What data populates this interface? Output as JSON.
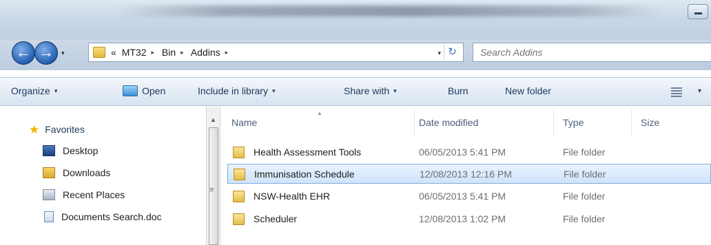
{
  "window": {
    "minimize_icon": "minimize-icon"
  },
  "navigation": {
    "back_icon": "back-arrow-icon",
    "forward_icon": "forward-arrow-icon",
    "back_glyph": "←",
    "forward_glyph": "→",
    "dropdown_glyph": "▾"
  },
  "address": {
    "overflow": "«",
    "crumbs": [
      "MT32",
      "Bin",
      "Addins"
    ],
    "separator": "▸",
    "refresh_glyph": "↻"
  },
  "search": {
    "placeholder": "Search Addins"
  },
  "toolbar": {
    "organize": "Organize",
    "open": "Open",
    "include_in_library": "Include in library",
    "share_with": "Share with",
    "burn": "Burn",
    "new_folder": "New folder",
    "arrow": "▾"
  },
  "navpane": {
    "favorites": "Favorites",
    "items": [
      {
        "label": "Desktop",
        "icon": "desktop-icon"
      },
      {
        "label": "Downloads",
        "icon": "downloads-folder-icon"
      },
      {
        "label": "Recent Places",
        "icon": "recent-places-icon"
      },
      {
        "label": "Documents Search.doc",
        "icon": "document-icon"
      }
    ]
  },
  "filelist": {
    "columns": {
      "name": "Name",
      "date_modified": "Date modified",
      "type": "Type",
      "size": "Size"
    },
    "rows": [
      {
        "name": "Health Assessment Tools",
        "date": "06/05/2013 5:41 PM",
        "type": "File folder",
        "selected": false
      },
      {
        "name": "Immunisation Schedule",
        "date": "12/08/2013 12:16 PM",
        "type": "File folder",
        "selected": true
      },
      {
        "name": "NSW-Health EHR",
        "date": "06/05/2013 5:41 PM",
        "type": "File folder",
        "selected": false
      },
      {
        "name": "Scheduler",
        "date": "12/08/2013 1:02 PM",
        "type": "File folder",
        "selected": false
      }
    ]
  },
  "colors": {
    "toolbar_text": "#1e395b",
    "selection_border": "#84acdd",
    "folder": "#e4bd4a"
  }
}
